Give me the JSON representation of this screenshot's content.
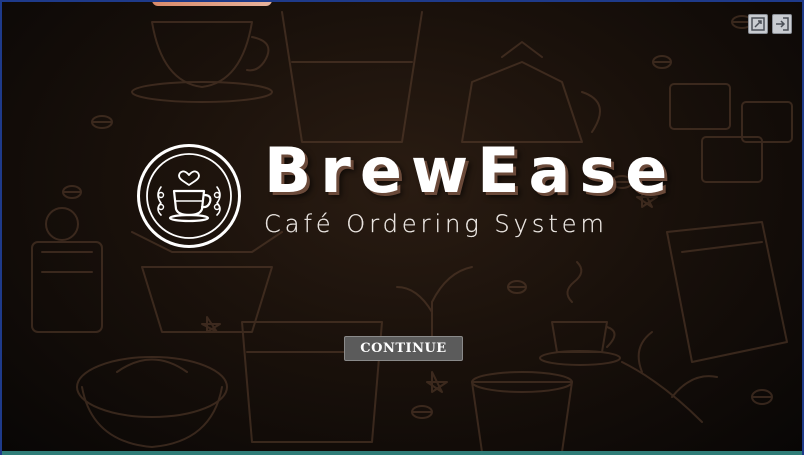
{
  "app": {
    "title": "BrewEase",
    "subtitle": "Café Ordering System"
  },
  "actions": {
    "continue_label": "CONTINUE"
  },
  "window_controls": [
    {
      "icon": "edit-window-icon"
    },
    {
      "icon": "exit-icon"
    }
  ],
  "colors": {
    "background": "#1a110b",
    "title_text": "#ffffff",
    "title_shadow": "#6b4a3a",
    "button_bg": "#5b5b5b",
    "window_border": "#1e3a8a",
    "bottom_strip": "#2f7d78"
  }
}
